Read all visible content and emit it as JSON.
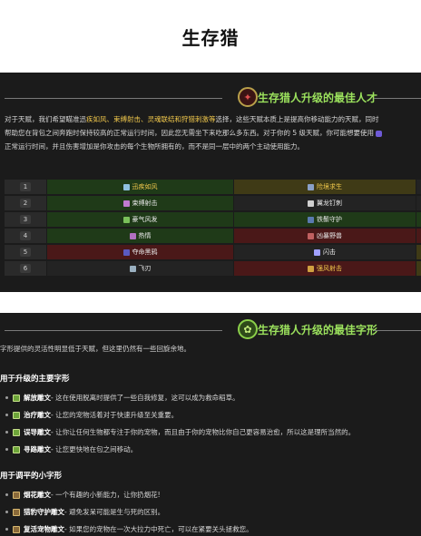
{
  "page_title": "生存猎",
  "talents_section": {
    "title": "生存猎人升级的最佳人才",
    "intro_line1_a": "对于天赋，我们希望瞄准迅",
    "intro_line1_hl": "疾如风、束缚射击、灵魂联结和狩猎刺激等",
    "intro_line1_b": "选择，这些天赋本质上是提高你移动能力的天赋，同时",
    "intro_line2": "帮助您在背包之间奔跑时保持较高的正常运行时间，因此您无需坐下来吃那么多东西。对于你的 5 级天赋，你可能想要使用",
    "intro_line3": "正常运行时间，并且伤害增加是你攻击的每个生物所拥有的，而不是同一层中的两个主动使用能力。",
    "rows": [
      {
        "level": "1",
        "c1": "迅疾如风",
        "c2": "险境求生"
      },
      {
        "level": "2",
        "c1": "束缚射击",
        "c2": "翼龙钉刺"
      },
      {
        "level": "3",
        "c1": "豪气风发",
        "c2": "铁鬃守护"
      },
      {
        "level": "4",
        "c1": "热情",
        "c2": "凶暴野兽"
      },
      {
        "level": "5",
        "c1": "夺命黑鸦",
        "c2": "闪击"
      },
      {
        "level": "6",
        "c1": "飞刃",
        "c2": "强风射击"
      }
    ]
  },
  "glyphs_section": {
    "title": "生存猎人升级的最佳字形",
    "intro": "字形提供的灵活性明显低于天赋，但这里仍然有一些回旋余地。",
    "major_heading": "用于升级的主要字形",
    "major": [
      {
        "name": "解放雕文",
        "desc": " - 这在使用脱离时提供了一些自我修复，这可以成为救命稻草。"
      },
      {
        "name": "治疗雕文",
        "desc": " - 让您的宠物活着对于快速升级至关重要。"
      },
      {
        "name": "误导雕文",
        "desc": " - 让你让任何生物都专注于你的宠物，而且由于你的宠物比你自己更容易治愈，所以这是理所当然的。"
      },
      {
        "name": "寻路雕文",
        "desc": " - 让您更快地在包之间移动。"
      }
    ],
    "minor_heading": "用于调平的小字形",
    "minor": [
      {
        "name": "烟花雕文",
        "desc": " - 一个有趣的小新能力，让你扔烟花!"
      },
      {
        "name": "猎豹守护雕文",
        "desc": " - 避免发呆可能是生与死的区别。"
      },
      {
        "name": "复活宠物雕文",
        "desc": " - 如果您的宠物在一次大拉力中死亡，可以在紧要关头拯救您。"
      }
    ]
  }
}
